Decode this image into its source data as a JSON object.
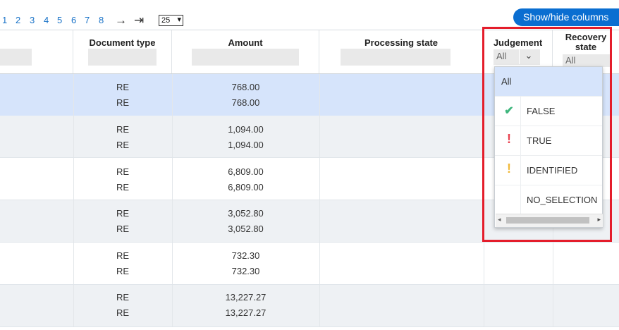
{
  "pagination": {
    "pages": [
      "1",
      "2",
      "3",
      "4",
      "5",
      "6",
      "7",
      "8"
    ],
    "next_icon": "arrow-right-icon",
    "last_icon": "arrow-last-icon",
    "page_size": "25"
  },
  "toolbar": {
    "show_hide_label": "Show/hide columns"
  },
  "columns": {
    "document_type": "Document type",
    "amount": "Amount",
    "processing_state": "Processing state",
    "judgement": "Judgement",
    "recovery_state": "Recovery state"
  },
  "filters": {
    "judgement_value": "All",
    "recovery_value": "All"
  },
  "rows": [
    {
      "doc1": "RE",
      "doc2": "RE",
      "amt1": "768.00",
      "amt2": "768.00"
    },
    {
      "doc1": "RE",
      "doc2": "RE",
      "amt1": "1,094.00",
      "amt2": "1,094.00"
    },
    {
      "doc1": "RE",
      "doc2": "RE",
      "amt1": "6,809.00",
      "amt2": "6,809.00"
    },
    {
      "doc1": "RE",
      "doc2": "RE",
      "amt1": "3,052.80",
      "amt2": "3,052.80"
    },
    {
      "doc1": "RE",
      "doc2": "RE",
      "amt1": "732.30",
      "amt2": "732.30"
    },
    {
      "doc1": "RE",
      "doc2": "RE",
      "amt1": "13,227.27",
      "amt2": "13,227.27"
    }
  ],
  "dropdown": {
    "options": [
      {
        "label": "All",
        "icon": ""
      },
      {
        "label": "FALSE",
        "icon": "check-icon"
      },
      {
        "label": "TRUE",
        "icon": "exclamation-red-icon"
      },
      {
        "label": "IDENTIFIED",
        "icon": "exclamation-yellow-icon"
      },
      {
        "label": "NO_SELECTION",
        "icon": ""
      }
    ]
  },
  "colors": {
    "accent": "#0a6ed1",
    "selected_row": "#d6e4fb",
    "alt_row": "#eef1f4",
    "highlight_frame": "#e41d2b",
    "check": "#3fb67d",
    "exclaim_red": "#e8414f",
    "exclaim_yellow": "#f0b93a"
  }
}
